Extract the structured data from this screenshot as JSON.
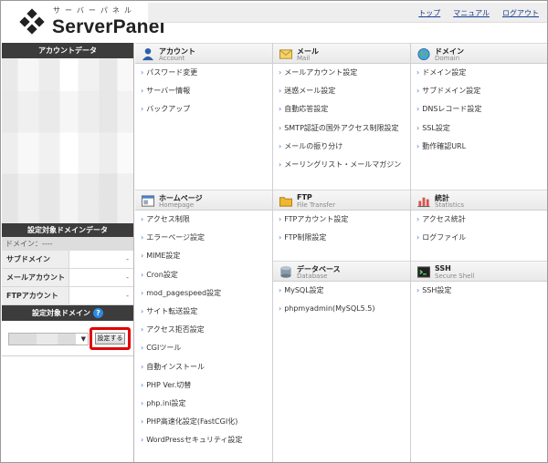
{
  "header": {
    "logo_sub": "サーバーパネル",
    "logo_main": "ServerPanel",
    "links": [
      "トップ",
      "マニュアル",
      "ログアウト"
    ]
  },
  "sidebar": {
    "account_title": "アカウントデータ",
    "target_domain_data_title": "設定対象ドメインデータ",
    "domain_label": "ドメイン：----",
    "rows": [
      {
        "label": "サブドメイン",
        "value": "-"
      },
      {
        "label": "メールアカウント",
        "value": "-"
      },
      {
        "label": "FTPアカウント",
        "value": "-"
      }
    ],
    "target_domain_title": "設定対象ドメイン",
    "help_glyph": "?",
    "set_button": "設定する"
  },
  "sections": {
    "account": {
      "title": "アカウント",
      "sub": "Account",
      "items": [
        "パスワード変更",
        "サーバー情報",
        "バックアップ"
      ]
    },
    "mail": {
      "title": "メール",
      "sub": "Mail",
      "items": [
        "メールアカウント設定",
        "迷惑メール設定",
        "自動応答設定",
        "SMTP認証の国外アクセス制限設定",
        "メールの振り分け",
        "メーリングリスト・メールマガジン"
      ]
    },
    "domain": {
      "title": "ドメイン",
      "sub": "Domain",
      "items": [
        "ドメイン設定",
        "サブドメイン設定",
        "DNSレコード設定",
        "SSL設定",
        "動作確認URL"
      ]
    },
    "homepage": {
      "title": "ホームページ",
      "sub": "Homepage",
      "items": [
        "アクセス制限",
        "エラーページ設定",
        "MIME設定",
        "Cron設定",
        "mod_pagespeed設定",
        "サイト転送設定",
        "アクセス拒否設定",
        "CGIツール",
        "自動インストール",
        "PHP Ver.切替",
        "php.ini設定",
        "PHP高速化設定(FastCGI化)",
        "WordPressセキュリティ設定"
      ]
    },
    "ftp": {
      "title": "FTP",
      "sub": "File Transfer",
      "items": [
        "FTPアカウント設定",
        "FTP制限設定"
      ]
    },
    "database": {
      "title": "データベース",
      "sub": "Database",
      "items": [
        "MySQL設定",
        "phpmyadmin(MySQL5.5)"
      ]
    },
    "stats": {
      "title": "統計",
      "sub": "Statistics",
      "items": [
        "アクセス統計",
        "ログファイル"
      ]
    },
    "ssh": {
      "title": "SSH",
      "sub": "Secure Shell",
      "items": [
        "SSH設定"
      ]
    }
  },
  "colors": {
    "dark_header": "#3c3c3c",
    "link": "#1a3c8f",
    "highlight_border": "#e30000",
    "arrow": "#3a74c4"
  }
}
